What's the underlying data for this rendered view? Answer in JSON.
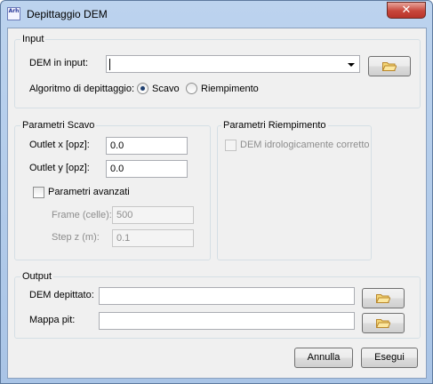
{
  "window": {
    "title": "Depittaggio DEM",
    "app_icon_text": "Arh"
  },
  "input_group": {
    "legend": "Input",
    "dem_label": "DEM in input:",
    "dem_value": "",
    "algorithm_label": "Algoritmo di depittaggio:",
    "option_scavo": "Scavo",
    "option_riempimento": "Riempimento",
    "selected": "Scavo"
  },
  "scavo_group": {
    "legend": "Parametri Scavo",
    "outlet_x_label": "Outlet x [opz]:",
    "outlet_x_value": "0.0",
    "outlet_y_label": "Outlet y [opz]:",
    "outlet_y_value": "0.0",
    "advanced_label": "Parametri avanzati",
    "frame_label": "Frame (celle):",
    "frame_value": "500",
    "step_label": "Step z (m):",
    "step_value": "0.1"
  },
  "riempimento_group": {
    "legend": "Parametri Riempimento",
    "dem_corrected_label": "DEM idrologicamente corretto"
  },
  "output_group": {
    "legend": "Output",
    "dem_output_label": "DEM depittato:",
    "dem_output_value": "",
    "pit_map_label": "Mappa pit:",
    "pit_map_value": ""
  },
  "buttons": {
    "cancel": "Annulla",
    "run": "Esegui"
  },
  "colors": {
    "accent": "#1e3f6f",
    "close_button": "#c7463a",
    "folder_icon": "#e8b84a"
  }
}
